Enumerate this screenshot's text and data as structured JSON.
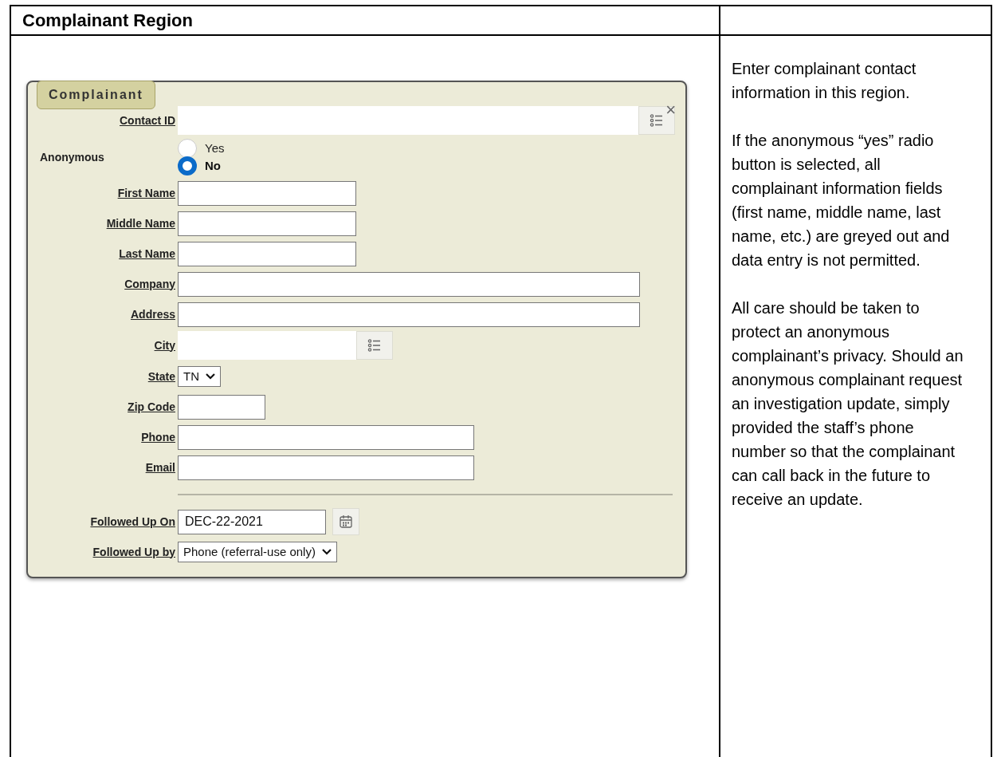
{
  "table": {
    "heading": "Complainant Region",
    "form": {
      "legend": "Complainant",
      "close": "×",
      "fields": [
        {
          "kind": "lookup",
          "label": "Contact ID"
        },
        {
          "kind": "radio",
          "label": "Anonymous",
          "options": [
            {
              "label": "Yes",
              "selected": false
            },
            {
              "label": "No",
              "selected": true
            }
          ]
        },
        {
          "kind": "text",
          "label": "First Name"
        },
        {
          "kind": "text",
          "label": "Middle Name"
        },
        {
          "kind": "text",
          "label": "Last Name"
        },
        {
          "kind": "text",
          "label": "Company"
        },
        {
          "kind": "text",
          "label": "Address"
        },
        {
          "kind": "lookup",
          "label": "City"
        },
        {
          "kind": "select",
          "label": "State",
          "value": "TN"
        },
        {
          "kind": "text",
          "label": "Zip Code"
        },
        {
          "kind": "text",
          "label": "Phone"
        },
        {
          "kind": "text",
          "label": "Email"
        },
        {
          "kind": "rule"
        },
        {
          "kind": "date",
          "label": "Followed Up On",
          "value": "DEC-22-2021"
        },
        {
          "kind": "select",
          "label": "Followed Up by",
          "value": "Phone (referral-use only)"
        }
      ]
    },
    "notes": [
      "Enter complainant contact information in this region.",
      "If the anonymous “yes” radio button is selected, all complainant information fields (first name, middle name, last name, etc.) are greyed out and data entry is not permitted.",
      "All care should be taken to protect an anonymous complainant’s privacy. Should an anonymous complainant request an investigation update, simply provided the staff’s phone number so that the complainant can call back in the future to receive an update."
    ]
  }
}
